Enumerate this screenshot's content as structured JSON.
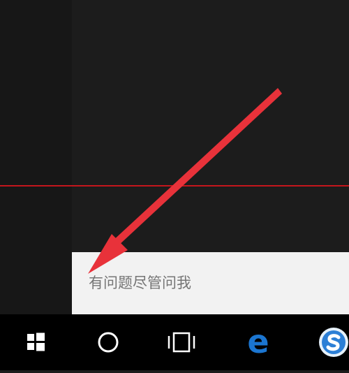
{
  "search": {
    "placeholder": "有问题尽管问我"
  },
  "taskbar": {
    "buttons": [
      {
        "icon": "windows-start-icon"
      },
      {
        "icon": "cortana-circle-icon"
      },
      {
        "icon": "task-view-icon"
      },
      {
        "icon": "edge-browser-icon"
      },
      {
        "icon": "sogou-browser-icon"
      }
    ]
  },
  "colors": {
    "annotation_red": "#e8323a",
    "taskbar_bg": "#000000",
    "search_bg": "#f2f2f2",
    "edge_blue": "#1b75d0"
  }
}
